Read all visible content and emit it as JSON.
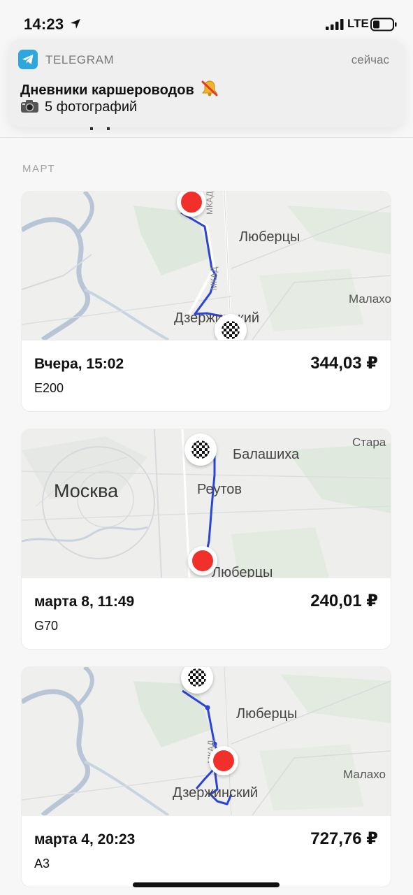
{
  "status_bar": {
    "time": "14:23",
    "network": "LTE"
  },
  "notification": {
    "app": "TELEGRAM",
    "time": "сейчас",
    "title": "Дневники каршероводов",
    "body": "5 фотографий"
  },
  "month": "МАРТ",
  "trips": [
    {
      "date": "Вчера, 15:02",
      "car": "E200",
      "price": "344,03 ₽",
      "map_labels": {
        "a": "Люберцы",
        "b": "Дзержинский",
        "c": "Малахо",
        "road": "МКАД",
        "road2": "МКАД"
      }
    },
    {
      "date": "марта 8, 11:49",
      "car": "G70",
      "price": "240,01 ₽",
      "map_labels": {
        "a": "Москва",
        "b": "Балашиха",
        "c": "Реутов",
        "d": "Люберцы",
        "e": "Стара"
      }
    },
    {
      "date": "марта 4, 20:23",
      "car": "A3",
      "price": "727,76 ₽",
      "map_labels": {
        "a": "Люберцы",
        "b": "Дзержинский",
        "c": "Малахо",
        "road": "МКАД"
      }
    }
  ],
  "colors": {
    "route": "#2a43d9",
    "start_pin": "#f2302b",
    "telegram": "#2ea6de"
  }
}
